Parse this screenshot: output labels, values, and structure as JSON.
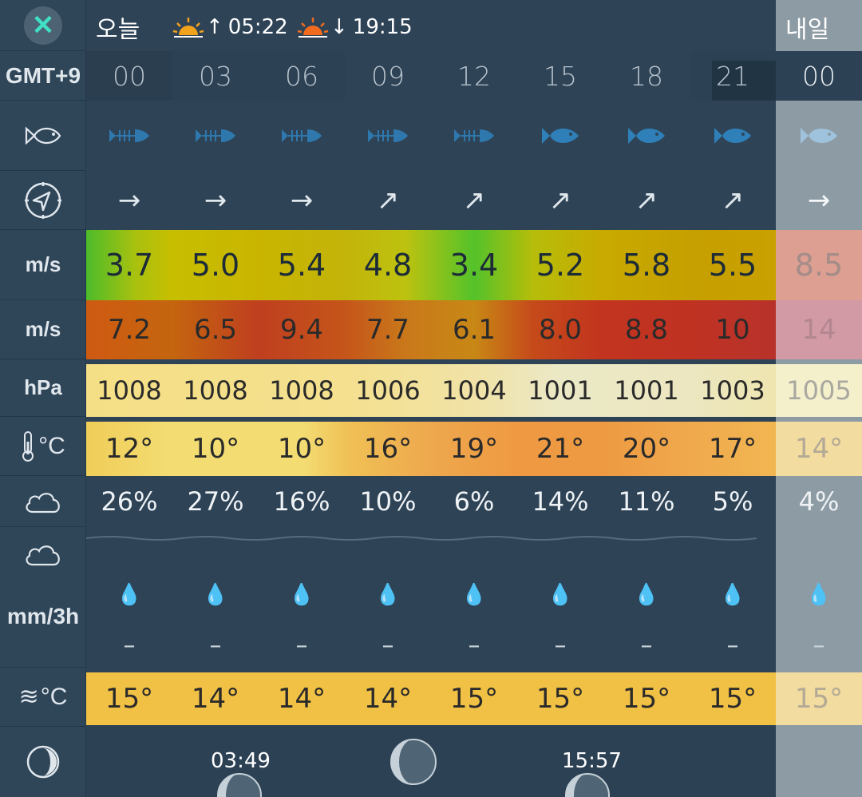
{
  "header": {
    "today": "오늘",
    "sunrise": "05:22",
    "sunset": "19:15",
    "tomorrow": "내일"
  },
  "sidebar": {
    "timezone": "GMT+9",
    "wind_unit": "m/s",
    "gust_unit": "m/s",
    "pressure_unit": "hPa",
    "temp_unit": "°C",
    "precip_unit": "mm/3h",
    "sea_temp_unit": "°C"
  },
  "hours": [
    "00",
    "03",
    "06",
    "09",
    "12",
    "15",
    "18",
    "21",
    "00"
  ],
  "wind_dir_arrows": [
    "→",
    "→",
    "→",
    "↗",
    "↗",
    "↗",
    "↗",
    "↗",
    "→"
  ],
  "wind_speed": [
    "3.7",
    "5.0",
    "5.4",
    "4.8",
    "3.4",
    "5.2",
    "5.8",
    "5.5",
    "8.5"
  ],
  "gusts": [
    "7.2",
    "6.5",
    "9.4",
    "7.7",
    "6.1",
    "8.0",
    "8.8",
    "10",
    "14"
  ],
  "pressure": [
    "1008",
    "1008",
    "1008",
    "1006",
    "1004",
    "1001",
    "1001",
    "1003",
    "1005"
  ],
  "temperature": [
    "12°",
    "10°",
    "10°",
    "16°",
    "19°",
    "21°",
    "20°",
    "17°",
    "14°"
  ],
  "cloud_cover": [
    "26%",
    "27%",
    "16%",
    "10%",
    "6%",
    "14%",
    "11%",
    "5%",
    "4%"
  ],
  "precip": [
    "–",
    "–",
    "–",
    "–",
    "–",
    "–",
    "–",
    "–",
    "–"
  ],
  "sea_temp": [
    "15°",
    "14°",
    "14°",
    "14°",
    "15°",
    "15°",
    "15°",
    "15°",
    "15°"
  ],
  "moon": {
    "moonrise": "03:49",
    "moonset": "15:57"
  },
  "colors": {
    "background": "#2e4356",
    "accent_close": "#3fe0c5",
    "fish_icon": "#2f7fb8"
  }
}
